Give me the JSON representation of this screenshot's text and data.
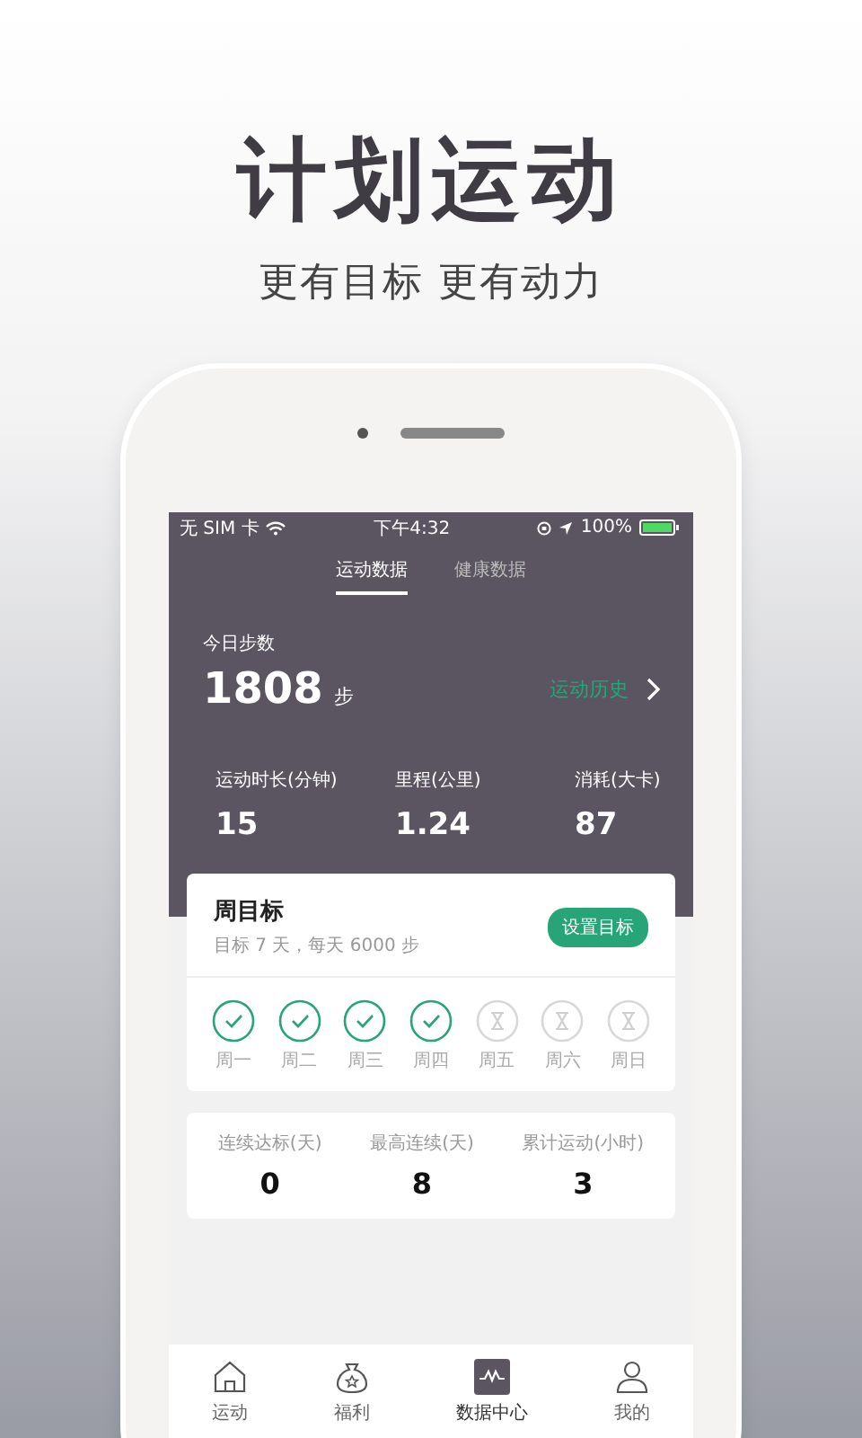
{
  "headline": "计划运动",
  "subheadline": "更有目标 更有动力",
  "status_bar": {
    "carrier": "无 SIM 卡",
    "time": "下午4:32",
    "battery": "100%"
  },
  "tabs": [
    {
      "label": "运动数据",
      "selected": true
    },
    {
      "label": "健康数据",
      "selected": false
    }
  ],
  "today": {
    "label": "今日步数",
    "steps": "1808",
    "unit": "步",
    "history_link": "运动历史"
  },
  "stats": [
    {
      "label": "运动时长(分钟)",
      "value": "15"
    },
    {
      "label": "里程(公里)",
      "value": "1.24"
    },
    {
      "label": "消耗(大卡)",
      "value": "87"
    }
  ],
  "weekly_goal": {
    "title": "周目标",
    "subtitle": "目标 7 天，每天 6000 步",
    "button": "设置目标",
    "days": [
      {
        "label": "周一",
        "done": true
      },
      {
        "label": "周二",
        "done": true
      },
      {
        "label": "周三",
        "done": true
      },
      {
        "label": "周四",
        "done": true
      },
      {
        "label": "周五",
        "done": false
      },
      {
        "label": "周六",
        "done": false
      },
      {
        "label": "周日",
        "done": false
      }
    ]
  },
  "summary": [
    {
      "label": "连续达标(天)",
      "value": "0"
    },
    {
      "label": "最高连续(天)",
      "value": "8"
    },
    {
      "label": "累计运动(小时)",
      "value": "3"
    }
  ],
  "nav": [
    {
      "label": "运动",
      "selected": false
    },
    {
      "label": "福利",
      "selected": false
    },
    {
      "label": "数据中心",
      "selected": true
    },
    {
      "label": "我的",
      "selected": false
    }
  ]
}
